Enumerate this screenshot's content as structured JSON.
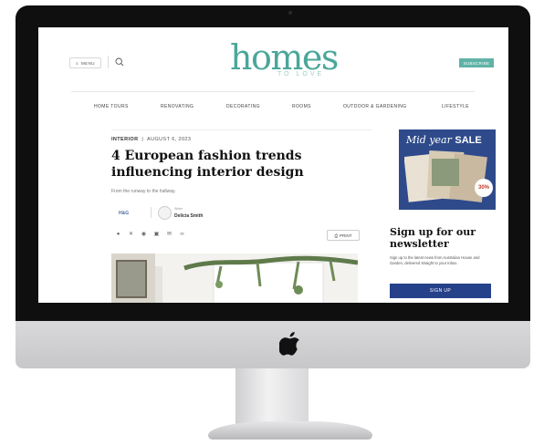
{
  "header": {
    "menu_label": "MENU",
    "logo": "homes",
    "logo_sub": "TO LOVE",
    "subscribe_label": "SUBSCRIBE"
  },
  "nav": {
    "items": [
      "HOME TOURS",
      "RENOVATING",
      "DECORATING",
      "ROOMS",
      "OUTDOOR & GARDENING",
      "LIFESTYLE"
    ]
  },
  "article": {
    "category": "INTERIOR",
    "separator": "|",
    "date": "AUGUST 6, 2023",
    "headline": "4 European fashion trends influencing interior design",
    "dek": "From the runway to the hallway.",
    "publisher": "H&G",
    "author_role": "Writer",
    "author_name": "Delicia Smith",
    "print_label": "PRINT"
  },
  "sidebar": {
    "ad_text_italic": "Mid year",
    "ad_text_bold": "SALE",
    "ad_badge": "30%",
    "newsletter_title": "Sign up for our newsletter",
    "newsletter_copy": "Sign up to the latest news from Australian House and Garden, delivered straight to your inbox.",
    "signup_label": "SIGN UP"
  },
  "icons": [
    "apple-logo-icon",
    "menu-icon",
    "search-icon",
    "facebook-icon",
    "x-icon",
    "pinterest-icon",
    "whatsapp-icon",
    "email-icon",
    "link-icon",
    "print-icon"
  ],
  "colors": {
    "brand_teal": "#4aa79a",
    "subscribe_teal": "#5fb3a6",
    "signup_navy": "#25418a",
    "ad_blue": "#2e4a8a"
  }
}
